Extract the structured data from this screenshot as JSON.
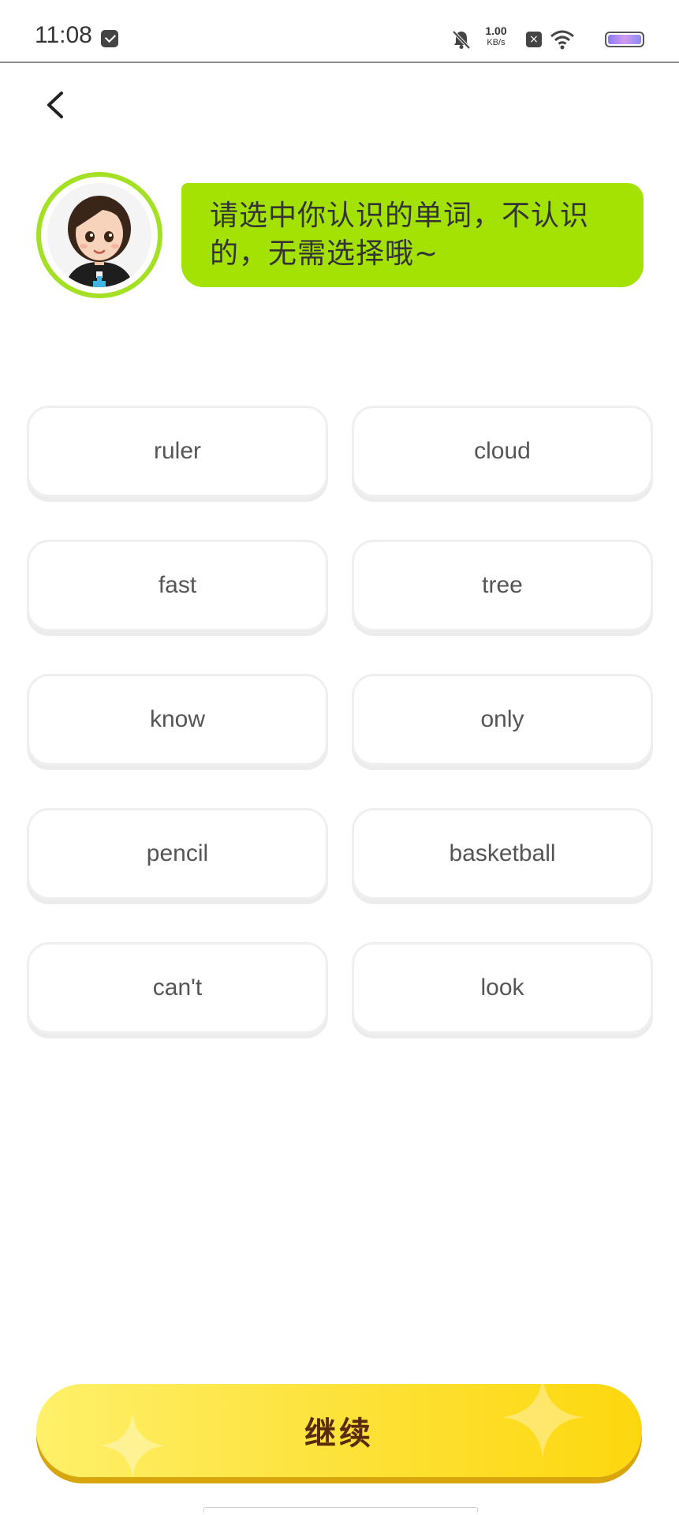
{
  "status_bar": {
    "time": "11:08",
    "net_speed_value": "1.00",
    "net_speed_unit": "KB/s"
  },
  "prompt": {
    "text": "请选中你认识的单词，不认识的，无需选择哦~"
  },
  "words": [
    "ruler",
    "cloud",
    "fast",
    "tree",
    "know",
    "only",
    "pencil",
    "basketball",
    "can't",
    "look"
  ],
  "continue_button": {
    "label": "继续"
  },
  "colors": {
    "accent_green": "#a4e204",
    "button_yellow": "#fde23a",
    "button_text": "#5a2a0a"
  }
}
